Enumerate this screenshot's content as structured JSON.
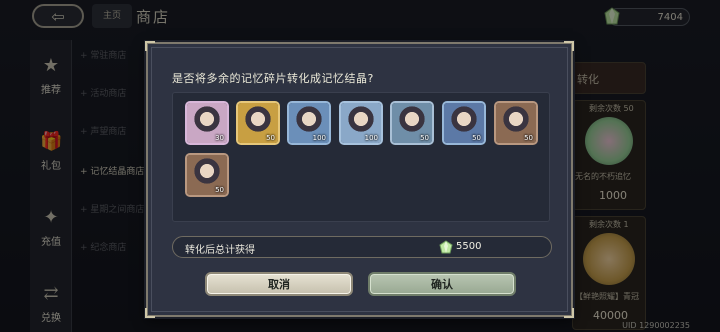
{
  "header": {
    "back_icon": "back-arrow-icon",
    "home_label": "主页",
    "title": "商店",
    "currency_amount": "7404",
    "currency_icon": "crystal-gem-icon"
  },
  "left_nav": [
    {
      "label": "推荐",
      "icon": "star-icon"
    },
    {
      "label": "礼包",
      "icon": "gift-icon"
    },
    {
      "label": "充值",
      "icon": "sparkle-icon"
    },
    {
      "label": "兑换",
      "icon": "exchange-icon"
    }
  ],
  "sub_nav": [
    {
      "label": "+ 常驻商店",
      "active": false
    },
    {
      "label": "+ 活动商店",
      "active": false
    },
    {
      "label": "+ 声望商店",
      "active": false
    },
    {
      "label": "+ 记忆结晶商店",
      "active": true
    },
    {
      "label": "+ 星期之间商店",
      "active": false
    },
    {
      "label": "+ 纪念商店",
      "active": false
    }
  ],
  "right_panel": {
    "card1_title": "转化",
    "card1_remaining": "剩余次数 50",
    "card1_item_name": "无名的不朽追忆",
    "card1_price": "1000",
    "card2_remaining": "剩余次数 1",
    "card2_item_name": "【鲜艳照耀】青冠",
    "card2_price": "40000"
  },
  "uid": "UID 1290002235",
  "dialog": {
    "question": "是否将多余的记忆碎片转化成记忆结晶?",
    "items": [
      {
        "count": "30",
        "frame": "#d8b7d9",
        "bg": "#c9a7c4"
      },
      {
        "count": "50",
        "frame": "#e6c77a",
        "bg": "#c89f42"
      },
      {
        "count": "100",
        "frame": "#97b7d8",
        "bg": "#6b8fb9"
      },
      {
        "count": "100",
        "frame": "#a7c2dd",
        "bg": "#8aa8c8"
      },
      {
        "count": "50",
        "frame": "#a9c0d6",
        "bg": "#6f8ea8"
      },
      {
        "count": "50",
        "frame": "#97b7d8",
        "bg": "#5c79a6"
      },
      {
        "count": "50",
        "frame": "#b99880",
        "bg": "#8b6a53"
      },
      {
        "count": "50",
        "frame": "#b99880",
        "bg": "#8b6a53"
      }
    ],
    "total_label": "转化后总计获得",
    "total_value": "5500",
    "total_icon": "crystal-gem-icon",
    "cancel_label": "取消",
    "confirm_label": "确认"
  },
  "colors": {
    "dialog_bg": "#2e3342",
    "dialog_border": "#7f7a6d",
    "cancel_button": "#d9d4c2",
    "confirm_button": "#a9b8a2"
  }
}
